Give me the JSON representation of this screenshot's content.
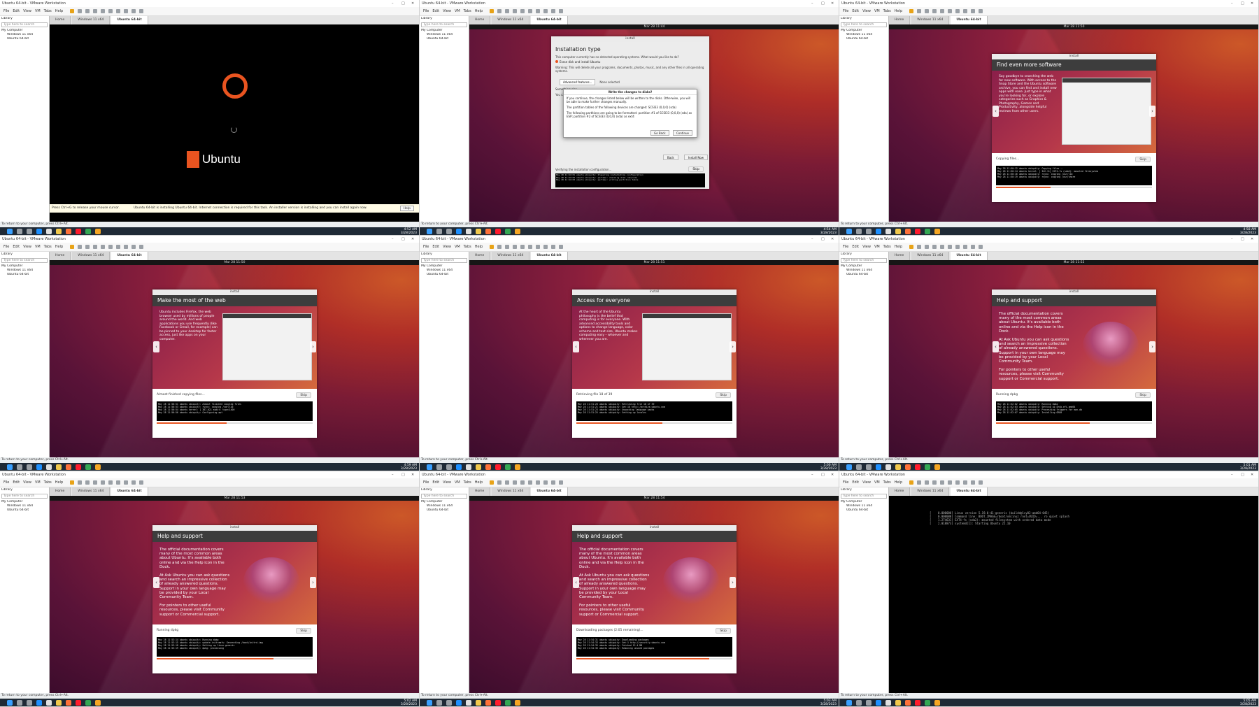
{
  "window": {
    "title": "Ubuntu 64-bit - VMware Workstation",
    "min": "–",
    "max": "□",
    "close": "✕"
  },
  "menu": [
    "File",
    "Edit",
    "View",
    "VM",
    "Tabs",
    "Help"
  ],
  "library": {
    "label": "Library",
    "close": "✕",
    "search_placeholder": "Type here to search",
    "root": "My Computer",
    "vms": [
      "Windows 11 x64",
      "Ubuntu 64-bit"
    ]
  },
  "tabs": {
    "home": "Home",
    "win11": "Windows 11 x64",
    "ubuntu": "Ubuntu 64-bit"
  },
  "status_text": "To return to your computer, press Ctrl+Alt.",
  "colors": {
    "ubuntu_orange": "#e95420",
    "taskbar": "#1f2a36"
  },
  "taskbar_icons": [
    "windows-start-icon",
    "search-icon",
    "task-view-icon",
    "edge-icon",
    "store-icon",
    "explorer-icon",
    "firefox-icon",
    "opera-icon",
    "chrome-icon",
    "vmware-icon"
  ],
  "panels": [
    {
      "kind": "boot",
      "clock": {
        "time": "4:52 AM",
        "date": "3/28/2023"
      },
      "brand": "Ubuntu",
      "notif": "Press Ctrl+G to release your mouse cursor.",
      "notif_msg": "Ubuntu 64-bit is installing Ubuntu 64-bit. Internet connection is required for this task. An installer version is installing and you can install again now.",
      "notif_btn": "Help"
    },
    {
      "kind": "installer",
      "top_clock": "Mar 28 11:44",
      "clock": {
        "time": "4:54 AM",
        "date": "3/28/2023"
      },
      "win_title": "install",
      "heading": "Installation type",
      "intro": "This computer currently has no detected operating systems. What would you like to do?",
      "option1": "Erase disk and install Ubuntu",
      "warning": "Warning: This will delete all your programs, documents, photos, music, and any other files in all operating systems.",
      "adv_btn": "Advanced features...",
      "none_sel": "None selected",
      "option2": "Something else",
      "option2_desc": "You can create or resize partitions yourself, or choose multiple partitions for Ubuntu.",
      "dialog": {
        "title": "Write the changes to disks?",
        "p1": "If you continue, the changes listed below will be written to the disks. Otherwise, you will be able to make further changes manually.",
        "p2": "The partition tables of the following devices are changed: SCSI33 (0,0,0) (sda)",
        "p3": "The following partitions are going to be formatted: partition #1 of SCSI33 (0,0,0) (sda) as ESP; partition #2 of SCSI33 (0,0,0) (sda) as ext4",
        "goback": "Go Back",
        "continue": "Continue"
      },
      "back": "Back",
      "install_now": "Install Now",
      "status": "Verifying the installation configuration...",
      "skip": "Skip",
      "log": [
        "May 28 11:44:01 ubuntu ubiquity: Preparing installation configuration",
        "May 28 11:44:02 ubuntu ubiquity: partman: checking disk /dev/sda",
        "May 28 11:44:03 ubuntu ubiquity: partman: writing partition table"
      ]
    },
    {
      "kind": "slide",
      "slide": "software",
      "top_clock": "Mar 28 11:50",
      "clock": {
        "time": "4:58 AM",
        "date": "3/28/2023"
      },
      "win_title": "install",
      "heading": "Find even more software",
      "text": [
        "Say goodbye to searching the web for new software. With access to the Snap Store and the Ubuntu software archive, you can find and install new apps with ease. Just type in what you're looking for, or explore categories such as Graphics & Photography, Games and Productivity, alongside helpful reviews from other users."
      ],
      "status": "Copying files...",
      "skip": "Skip",
      "progress": 0.35,
      "log": [
        "May 28 11:50:12 ubuntu ubiquity: Copying files...",
        "May 28 11:50:14 ubuntu kernel: [ 342.11] EXT4-fs (sda2): mounted filesystem",
        "May 28 11:50:16 ubuntu ubiquity: rsync: copying /usr/lib",
        "May 28 11:50:19 ubuntu ubiquity: rsync: copying /usr/share"
      ]
    },
    {
      "kind": "slide",
      "slide": "web",
      "top_clock": "Mar 28 11:50",
      "clock": {
        "time": "4:59 AM",
        "date": "3/28/2023"
      },
      "win_title": "install",
      "heading": "Make the most of the web",
      "text": [
        "Ubuntu includes Firefox, the web browser used by millions of people around the world. And web applications you use frequently (like Facebook or Gmail, for example) can be pinned to your desktop for faster access, just like apps on your computer."
      ],
      "status": "Almost finished copying files...",
      "skip": "Skip",
      "progress": 0.45,
      "log": [
        "May 28 11:50:51 ubuntu ubiquity: Almost finished copying files",
        "May 28 11:50:53 ubuntu ubiquity: rsync: copying /var/lib",
        "May 28 11:50:54 ubuntu kernel: [ 381.02] audit: type=1400",
        "May 28 11:50:56 ubuntu ubiquity: Configuring apt"
      ]
    },
    {
      "kind": "slide",
      "slide": "access",
      "top_clock": "Mar 28 11:51",
      "clock": {
        "time": "5:00 AM",
        "date": "3/28/2023"
      },
      "win_title": "install",
      "heading": "Access for everyone",
      "text": [
        "At the heart of the Ubuntu philosophy is the belief that computing is for everyone. With advanced accessibility tools and options to change language, color scheme and text size, Ubuntu makes computing easy – whoever and wherever you are."
      ],
      "status": "Retrieving file 18 of 39",
      "skip": "Skip",
      "progress": 0.55,
      "log": [
        "May 28 11:51:20 ubuntu ubiquity: Retrieving file 18 of 39",
        "May 28 11:51:21 ubuntu ubiquity: Get:18 http://archive.ubuntu.com",
        "May 28 11:51:23 ubuntu ubiquity: Unpacking language packs",
        "May 28 11:51:25 ubuntu ubiquity: Setting up locales"
      ]
    },
    {
      "kind": "slide",
      "slide": "help",
      "top_clock": "Mar 28 11:52",
      "clock": {
        "time": "5:01 AM",
        "date": "3/28/2023"
      },
      "win_title": "install",
      "heading": "Help and support",
      "text_parts": {
        "p1": "The official documentation covers many of the most common areas about Ubuntu. It's available both online and via the Help icon in the Dock.",
        "p2": "At Ask Ubuntu you can ask questions and search an impressive collection of already answered questions. Support in your own language may be provided by your Local Community Team.",
        "p3": "For pointers to other useful resources, please visit Community support or Commercial support."
      },
      "status": "Running dpkg",
      "skip": "Skip",
      "progress": 0.6,
      "log": [
        "May 28 11:52:02 ubuntu ubiquity: Running dpkg",
        "May 28 11:52:03 ubuntu ubiquity: Setting up grub-efi-amd64",
        "May 28 11:52:05 ubuntu ubiquity: Processing triggers for man-db",
        "May 28 11:52:07 ubuntu ubiquity: Installing GRUB"
      ]
    },
    {
      "kind": "slide",
      "slide": "help",
      "top_clock": "Mar 28 11:53",
      "clock": {
        "time": "5:02 AM",
        "date": "3/28/2023"
      },
      "win_title": "install",
      "heading": "Help and support",
      "text_parts": {
        "p1": "The official documentation covers many of the most common areas about Ubuntu. It's available both online and via the Help icon in the Dock.",
        "p2": "At Ask Ubuntu you can ask questions and search an impressive collection of already answered questions. Support in your own language may be provided by your Local Community Team.",
        "p3": "For pointers to other useful resources, please visit Community support or Commercial support."
      },
      "status": "Running dpkg",
      "skip": "Skip",
      "progress": 0.75,
      "log": [
        "May 28 11:53:14 ubuntu ubiquity: Running dpkg",
        "May 28 11:53:15 ubuntu ubiquity: update-initramfs: Generating /boot/initrd.img",
        "May 28 11:53:18 ubuntu ubiquity: Setting up linux-generic",
        "May 28 11:53:19 ubuntu ubiquity: dpkg: processing"
      ]
    },
    {
      "kind": "slide",
      "slide": "help",
      "top_clock": "Mar 28 11:54",
      "clock": {
        "time": "5:03 AM",
        "date": "3/28/2023"
      },
      "win_title": "install",
      "heading": "Help and support",
      "text_parts": {
        "p1": "The official documentation covers many of the most common areas about Ubuntu. It's available both online and via the Help icon in the Dock.",
        "p2": "At Ask Ubuntu you can ask questions and search an impressive collection of already answered questions. Support in your own language may be provided by your Local Community Team.",
        "p3": "For pointers to other useful resources, please visit Community support or Commercial support."
      },
      "status": "Downloading packages (2:05 remaining)...",
      "skip": "Skip",
      "progress": 0.85,
      "log": [
        "May 28 11:54:31 ubuntu ubiquity: Downloading packages",
        "May 28 11:54:33 ubuntu ubiquity: Get:1 http://security.ubuntu.com",
        "May 28 11:54:35 ubuntu ubiquity: Fetched 12.4 MB",
        "May 28 11:54:36 ubuntu ubiquity: Removing unused packages"
      ]
    },
    {
      "kind": "kernel",
      "clock": {
        "time": "5:05 AM",
        "date": "3/28/2023"
      },
      "lines": [
        "[    0.000000] Linux version 5.19.0-41-generic (buildd@lcy02-amd64-045)",
        "[    0.000000] Command line: BOOT_IMAGE=/boot/vmlinuz root=UUID=... ro quiet splash",
        "[    1.274631] EXT4-fs (sda2): mounted filesystem with ordered data mode",
        "[    2.018873] systemd[1]: Starting Ubuntu 22.10"
      ]
    }
  ]
}
